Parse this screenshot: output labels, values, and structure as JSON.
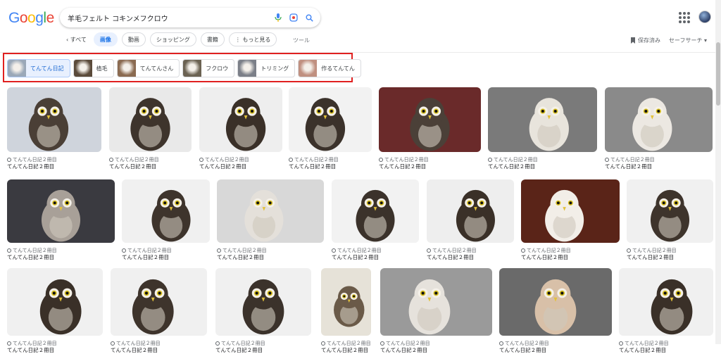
{
  "logo": [
    "G",
    "o",
    "o",
    "g",
    "l",
    "e"
  ],
  "logo_colors": [
    "#4285f4",
    "#ea4335",
    "#fbbc05",
    "#4285f4",
    "#34a853",
    "#ea4335"
  ],
  "search": {
    "value": "羊毛フェルト コキンメフクロウ"
  },
  "tabs": [
    {
      "label": "‹ すべて",
      "active": false,
      "back": true
    },
    {
      "label": "画像",
      "active": true
    },
    {
      "label": "動画",
      "active": false
    },
    {
      "label": "ショッピング",
      "active": false
    },
    {
      "label": "書籍",
      "active": false
    },
    {
      "label": "⋮ もっと見る",
      "active": false
    }
  ],
  "tools_label": "ツール",
  "saved_label": "保存済み",
  "safesearch_label": "セーフサーチ ▾",
  "chips": [
    {
      "label": "てんてん日記",
      "selected": true,
      "color": "#9aa8b8"
    },
    {
      "label": "植毛",
      "selected": false,
      "color": "#5a4a3a"
    },
    {
      "label": "てんてんさん",
      "selected": false,
      "color": "#8a6a50"
    },
    {
      "label": "フクロウ",
      "selected": false,
      "color": "#6b6252"
    },
    {
      "label": "トリミング",
      "selected": false,
      "color": "#7b7f88"
    },
    {
      "label": "作るてんてん",
      "selected": false,
      "color": "#c09080"
    }
  ],
  "results_rows": [
    [
      {
        "source": "てんてん日記２冊目",
        "title": "てんてん日記２冊目",
        "bg": "#cfd4dc",
        "owl": "#4a3f36"
      },
      {
        "source": "てんてん日記２冊目",
        "title": "てんてん日記２冊目",
        "bg": "#e9e9e9",
        "owl": "#3e342c"
      },
      {
        "source": "てんてん日記２冊目",
        "title": "てんてん日記２冊目",
        "bg": "#eeeeee",
        "owl": "#3a3028"
      },
      {
        "source": "てんてん日記２冊目",
        "title": "てんてん日記２冊目",
        "bg": "#f2f2f2",
        "owl": "#3b322b"
      },
      {
        "source": "てんてん日記２冊目",
        "title": "てんてん日記２冊目",
        "bg": "#6a2a2a",
        "owl": "#4b4038"
      },
      {
        "source": "てんてん日記２冊目",
        "title": "てんてん日記２冊目",
        "bg": "#7a7a7a",
        "owl": "#e8e4dc"
      },
      {
        "source": "てんてん日記２冊目",
        "title": "てんてん日記２冊目",
        "bg": "#8a8a8a",
        "owl": "#ece8e2"
      }
    ],
    [
      {
        "source": "てんてん日記２冊目",
        "title": "てんてん日記２冊目",
        "bg": "#3a3a40",
        "owl": "#a8a098"
      },
      {
        "source": "てんてん日記２冊目",
        "title": "てんてん日記２冊目",
        "bg": "#f0f0f0",
        "owl": "#3e342c"
      },
      {
        "source": "てんてん日記２冊目",
        "title": "てんてん日記２冊目",
        "bg": "#d8d8d8",
        "owl": "#e4e0da"
      },
      {
        "source": "てんてん日記２冊目",
        "title": "てんてん日記２冊目",
        "bg": "#f2f2f2",
        "owl": "#3b322b"
      },
      {
        "source": "てんてん日記２冊目",
        "title": "てんてん日記２冊目",
        "bg": "#eeeeee",
        "owl": "#3a3028"
      },
      {
        "source": "てんてん日記２冊目",
        "title": "てんてん日記２冊目",
        "bg": "#5a2418",
        "owl": "#f2eee8"
      },
      {
        "source": "てんてん日記２冊目",
        "title": "てんてん日記２冊目",
        "bg": "#f0f0f0",
        "owl": "#3e342c"
      }
    ],
    [
      {
        "source": "てんてん日記２冊目",
        "title": "てんてん日記２冊目",
        "bg": "#f0f0f0",
        "owl": "#3a3028"
      },
      {
        "source": "てんてん日記２冊目",
        "title": "てんてん日記２冊目",
        "bg": "#f0f0f0",
        "owl": "#3e342c"
      },
      {
        "source": "てんてん日記２冊目",
        "title": "てんてん日記２冊目",
        "bg": "#f0f0f0",
        "owl": "#3b322b"
      },
      {
        "source": "てんてん日記２冊目",
        "title": "てんてん日記２冊目",
        "bg": "#e6e2d8",
        "owl": "#6a5a48"
      },
      {
        "source": "てんてん日記２冊目",
        "title": "てんてん日記２冊目",
        "bg": "#9a9a9a",
        "owl": "#e6e2dc"
      },
      {
        "source": "てんてん日記２冊目",
        "title": "てんてん日記２冊目",
        "bg": "#6a6a6a",
        "owl": "#d8c0a8"
      },
      {
        "source": "てんてん日記２冊目",
        "title": "てんてん日記２冊目",
        "bg": "#f0f0f0",
        "owl": "#3a3028"
      }
    ]
  ]
}
